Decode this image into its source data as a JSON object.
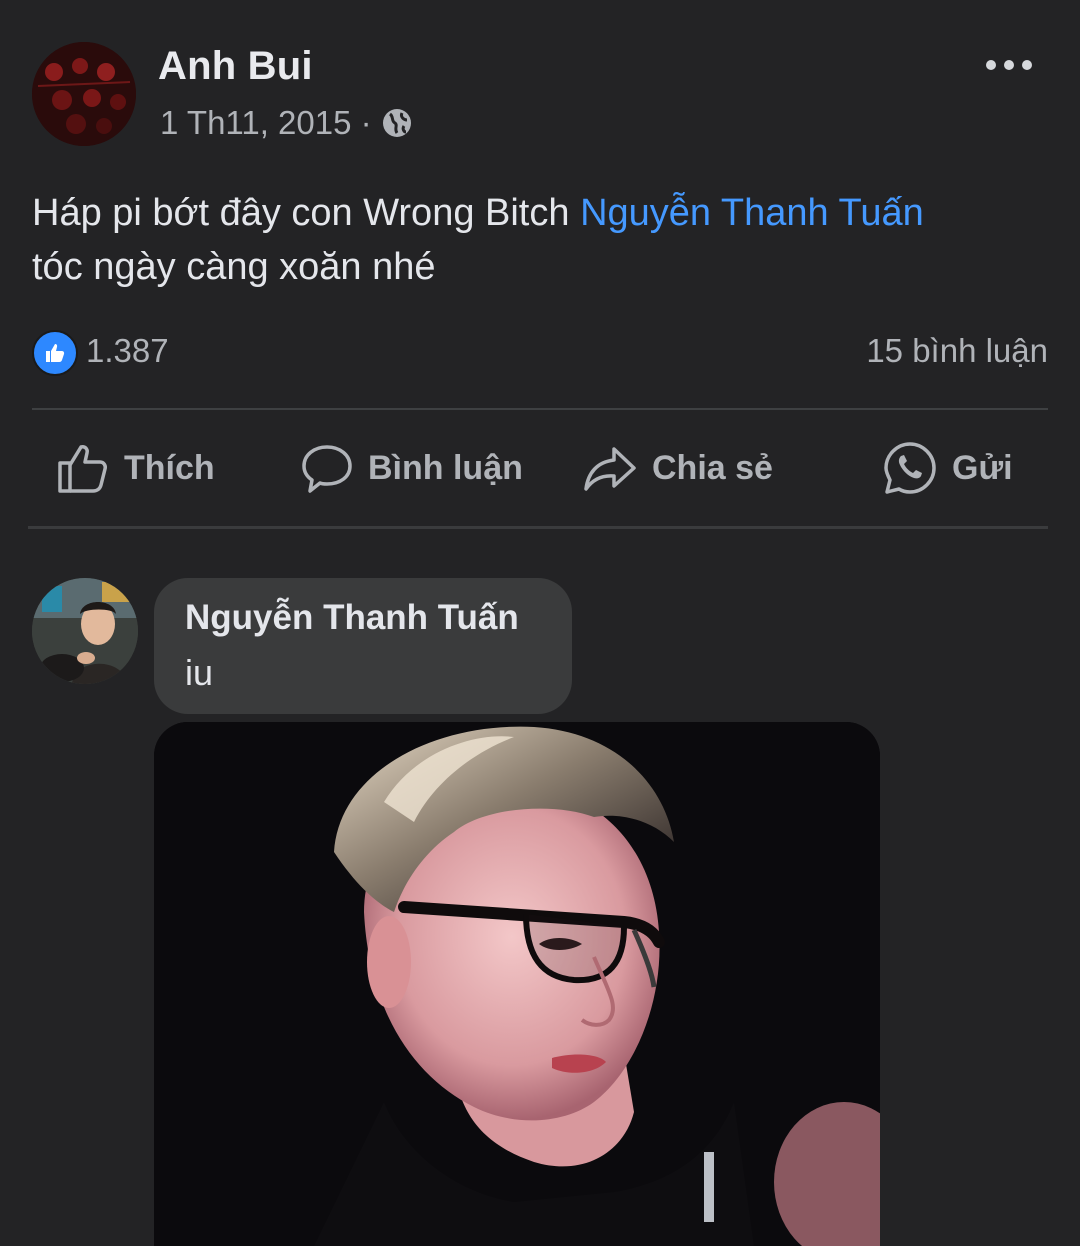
{
  "post": {
    "author": "Anh Bui",
    "date": "1 Th11, 2015 ·",
    "privacy_icon": "globe-icon",
    "text_before": "Háp pi bớt đây con Wrong Bitch ",
    "mention": "Nguyễn Thanh Tuấn",
    "text_after": "tóc ngày càng xoăn nhé"
  },
  "reactions": {
    "like_count": "1.387",
    "comments": "15 bình luận"
  },
  "actions": {
    "like": "Thích",
    "comment": "Bình luận",
    "share": "Chia sẻ",
    "send": "Gửi"
  },
  "comment": {
    "author": "Nguyễn Thanh Tuấn",
    "text": "iu"
  },
  "colors": {
    "background": "#232325",
    "mention": "#4599ff",
    "bubble": "#3a3b3c",
    "like_badge": "#2d88ff"
  }
}
